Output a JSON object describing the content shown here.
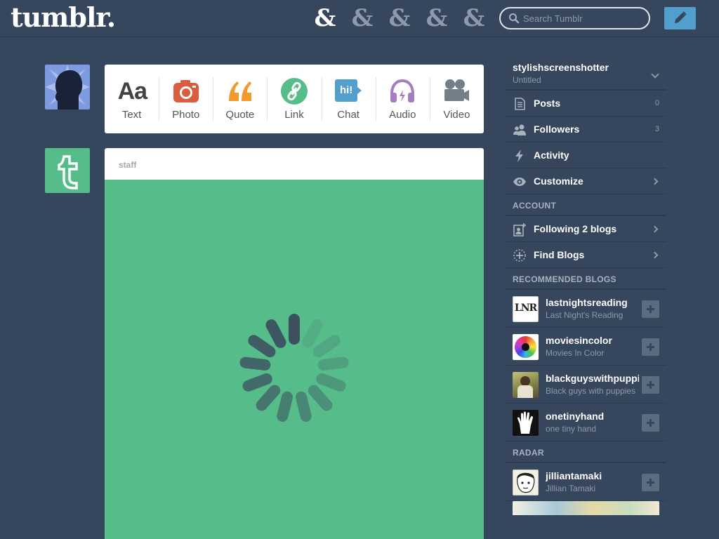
{
  "header": {
    "logo": "tumblr.",
    "nav_glyph": "&",
    "nav": [
      "dashboard",
      "explore",
      "inbox",
      "messages",
      "account"
    ],
    "search_placeholder": "Search Tumblr"
  },
  "post_types": [
    {
      "label": "Text",
      "glyph": "Aa",
      "icon": "text-icon",
      "color": "#444444"
    },
    {
      "label": "Photo",
      "icon": "camera-icon",
      "color": "#d95e40"
    },
    {
      "label": "Quote",
      "icon": "quote-icon",
      "color": "#f2992e"
    },
    {
      "label": "Link",
      "icon": "link-icon",
      "color": "#56bc8a"
    },
    {
      "label": "Chat",
      "glyph": "hi!",
      "icon": "chat-icon",
      "color": "#529ecc"
    },
    {
      "label": "Audio",
      "icon": "headphones-icon",
      "color": "#a77dc2"
    },
    {
      "label": "Video",
      "icon": "video-camera-icon",
      "color": "#748089"
    }
  ],
  "post": {
    "author": "staff",
    "body_color": "#56bc8a",
    "state": "loading"
  },
  "sidebar": {
    "blog": {
      "name": "stylishscreenshotter",
      "subtitle": "Untitled"
    },
    "items": [
      {
        "label": "Posts",
        "count": "0",
        "icon": "posts-icon"
      },
      {
        "label": "Followers",
        "count": "3",
        "icon": "followers-icon"
      },
      {
        "label": "Activity",
        "icon": "lightning-icon"
      },
      {
        "label": "Customize",
        "icon": "eye-icon"
      }
    ],
    "account_title": "ACCOUNT",
    "account_items": [
      {
        "label": "Following 2 blogs",
        "icon": "following-icon"
      },
      {
        "label": "Find Blogs",
        "icon": "find-blogs-icon"
      }
    ],
    "recommended_title": "RECOMMENDED BLOGS",
    "recommended": [
      {
        "name": "lastnightsreading",
        "subtitle": "Last Night's Reading",
        "avatar_text": "LNR"
      },
      {
        "name": "moviesincolor",
        "subtitle": "Movies In Color"
      },
      {
        "name": "blackguyswithpuppies",
        "subtitle": "Black guys with puppies"
      },
      {
        "name": "onetinyhand",
        "subtitle": "one tiny hand"
      }
    ],
    "radar_title": "RADAR",
    "radar": [
      {
        "name": "jilliantamaki",
        "subtitle": "Jillian Tamaki"
      }
    ]
  },
  "colors": {
    "background": "#36465d",
    "accent": "#529ecc",
    "post_green": "#56bc8a"
  }
}
